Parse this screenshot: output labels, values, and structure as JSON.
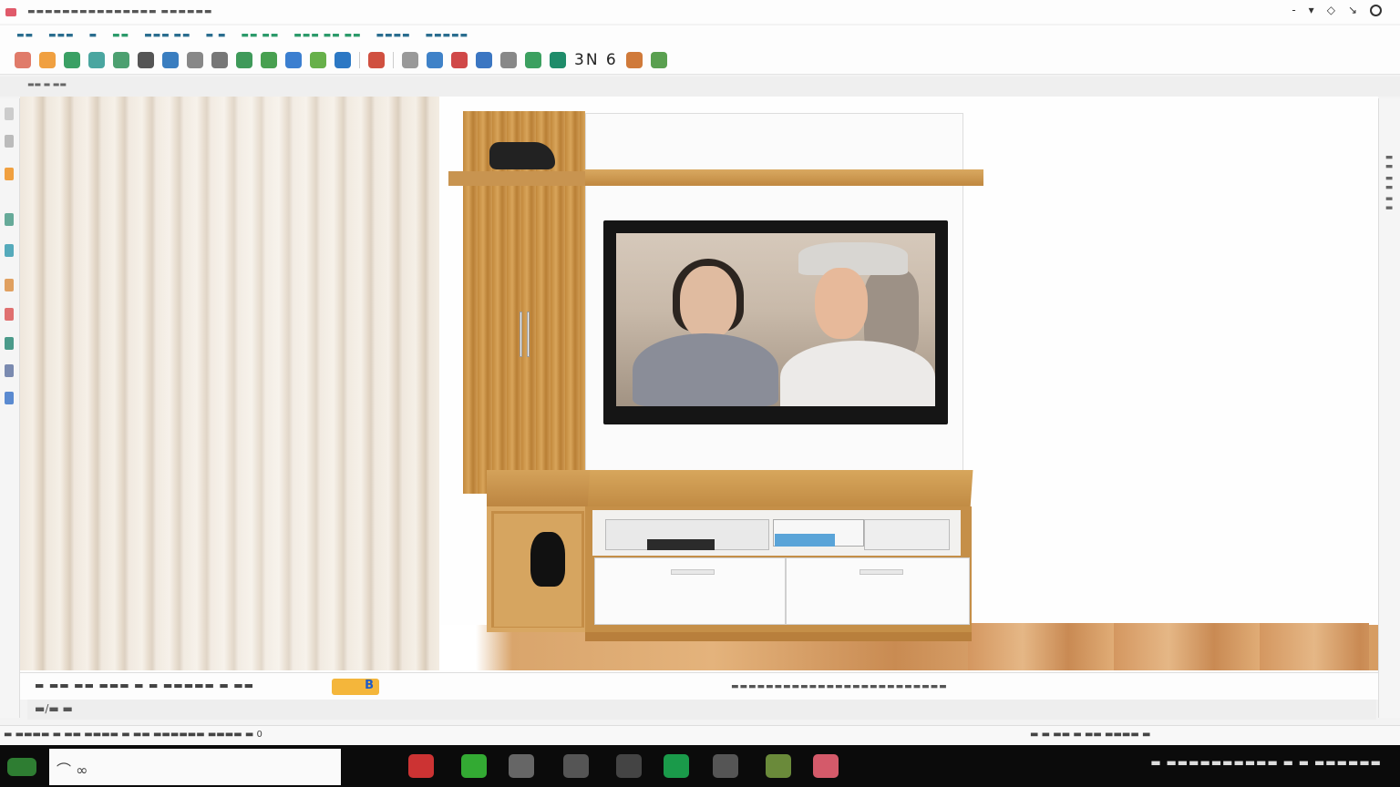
{
  "window": {
    "title": "▬▬▬▬▬▬▬▬▬▬▬▬▬▬▬ ▬▬▬▬▬▬",
    "controls": [
      "-",
      "▾",
      "◇",
      "↘"
    ]
  },
  "menu": {
    "items": [
      "▬▬",
      "▬▬▬",
      "▬",
      "▬▬",
      "▬▬▬ ▬▬",
      "▬ ▬",
      "▬▬ ▬▬",
      "▬▬▬ ▬▬ ▬▬",
      "▬▬▬▬",
      "▬▬▬▬▬"
    ]
  },
  "toolbar": {
    "text_label": "3N 6"
  },
  "subbar": {
    "label": "▬▬ ▬ ▬▬"
  },
  "right_panel": {
    "label": "▬▬ ▬▬ ▬▬"
  },
  "scene": {
    "objects": [
      "curtain",
      "tv-wall-unit",
      "television",
      "camera",
      "media-cabinet",
      "drawers",
      "wood-floor"
    ]
  },
  "status": {
    "left_text": "▬ ▬▬ ▬▬ ▬▬▬ ▬ ▬ ▬▬▬▬▬ ▬ ▬▬",
    "badge": "B",
    "mid_text": "▬▬▬▬▬▬▬▬▬▬▬▬▬▬▬▬▬▬▬▬▬▬▬▬▬"
  },
  "sheets": {
    "label": "▬/▬ ▬"
  },
  "bottom": {
    "left_text": "▬ ▬▬▬▬ ▬ ▬▬ ▬▬▬▬ ▬ ▬▬ ▬▬▬▬▬▬ ▬▬▬▬ ▬ 0",
    "right_text": "▬ ▬ ▬▬ ▬ ▬▬ ▬▬▬▬ ▬"
  },
  "taskbar": {
    "tray_text": "▬ ▬▬▬▬▬▬▬▬▬▬   ▬ ▬ ▬▬▬▬▬▬"
  },
  "colors": {
    "wood": "#c8924c",
    "curtain": "#efe7dc",
    "accent_red": "#e05a6a",
    "accent_green": "#2b9a6a",
    "accent_blue": "#1f5cc7",
    "badge_yellow": "#f4b63b",
    "taskbar": "#0b0b0b"
  }
}
